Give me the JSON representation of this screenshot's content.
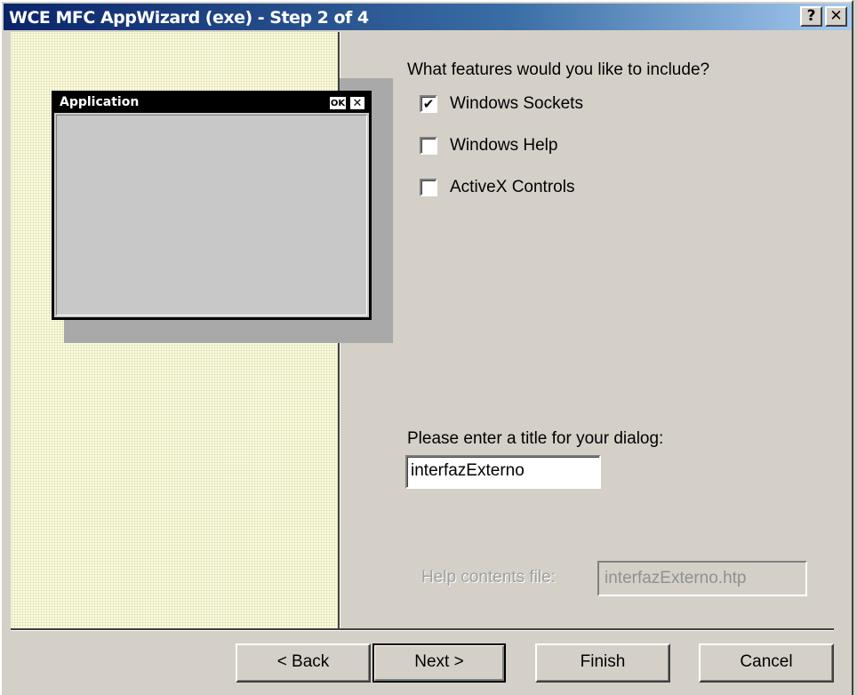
{
  "window": {
    "title": "WCE MFC AppWizard (exe) - Step 2 of 4",
    "help_glyph": "?",
    "close_glyph": "✕",
    "titlebar_color": "#0a246a"
  },
  "preview": {
    "title": "Application",
    "ok_label": "OK",
    "close_glyph": "✕"
  },
  "features": {
    "question": "What features would you like to include?",
    "options": [
      {
        "label": "Windows Sockets",
        "checked": true
      },
      {
        "label": "Windows Help",
        "checked": false
      },
      {
        "label": "ActiveX Controls",
        "checked": false
      }
    ],
    "check_glyph": "✔"
  },
  "dialog_title": {
    "prompt": "Please enter a title for your dialog:",
    "value": "interfazExterno"
  },
  "help_contents": {
    "label": "Help contents file:",
    "value": "interfazExterno.htp",
    "disabled": true
  },
  "buttons": {
    "back": "< Back",
    "next": "Next >",
    "finish": "Finish",
    "cancel": "Cancel"
  }
}
